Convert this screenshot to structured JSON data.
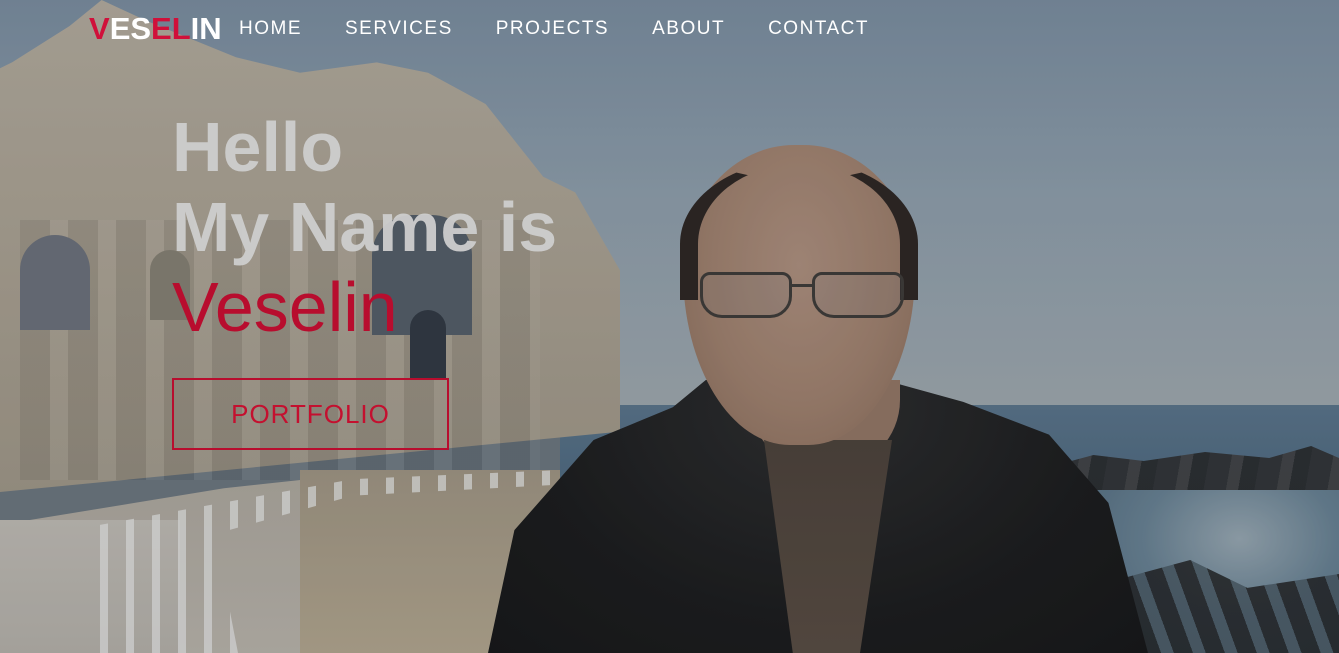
{
  "brand": {
    "logo_part1": "VES",
    "logo_part2": "EL",
    "logo_part3": "IN",
    "logo_first_letter": "V",
    "accent_color": "#d0103a"
  },
  "nav": {
    "items": [
      {
        "label": "HOME"
      },
      {
        "label": "SERVICES"
      },
      {
        "label": "PROJECTS"
      },
      {
        "label": "ABOUT"
      },
      {
        "label": "CONTACT"
      }
    ]
  },
  "hero": {
    "line1": "Hello",
    "line2": "My Name is",
    "name": "Veselin",
    "cta_label": "PORTFOLIO",
    "text_color": "#cdcdcd",
    "name_color": "#b80d2e"
  }
}
